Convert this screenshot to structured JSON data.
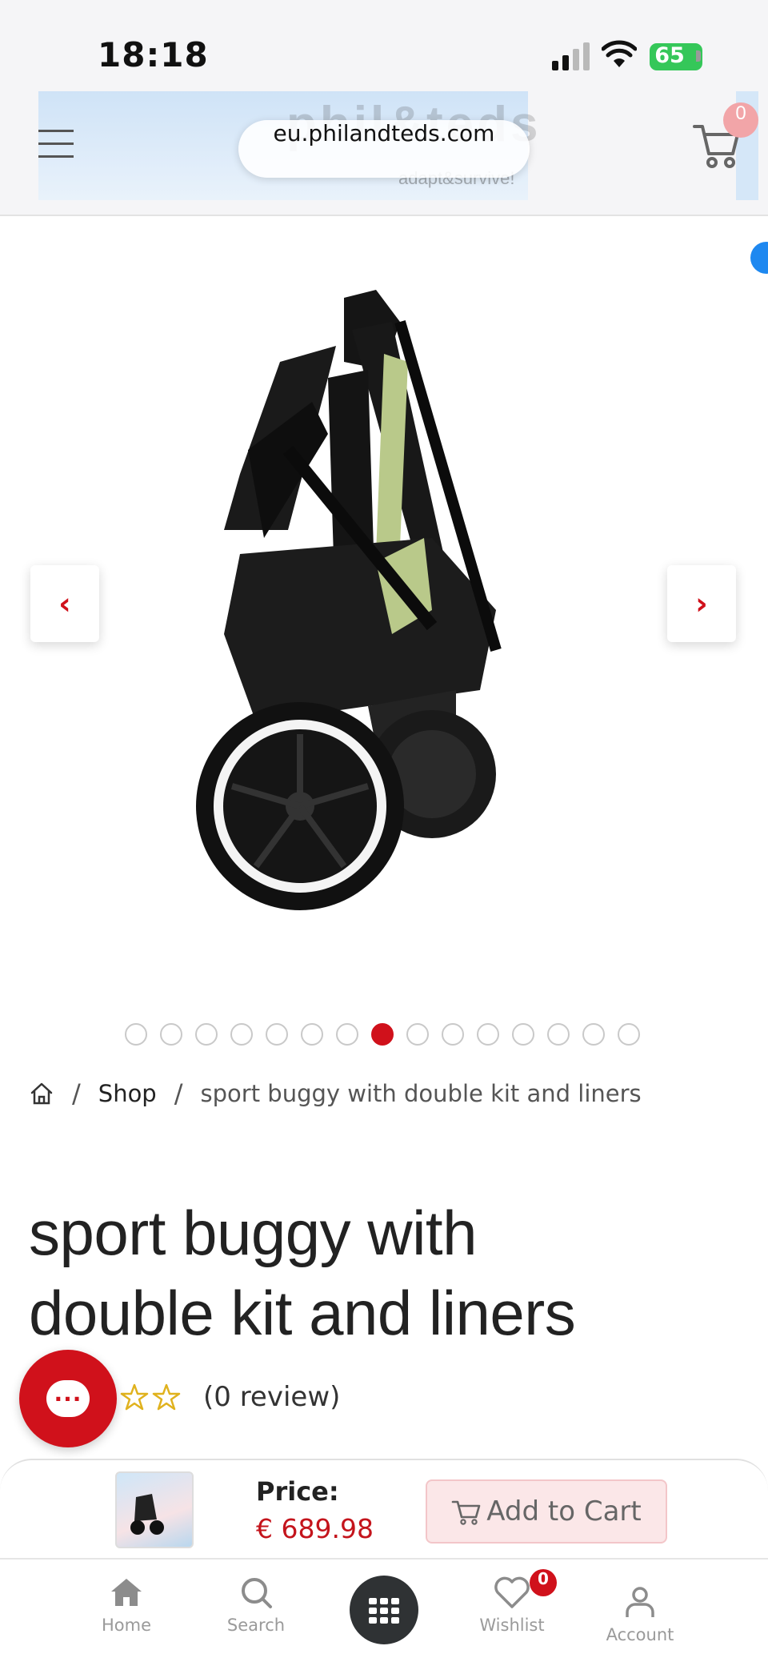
{
  "status_bar": {
    "time": "18:18",
    "battery": "65"
  },
  "header": {
    "url": "eu.philandteds.com",
    "cart_count": "0"
  },
  "gallery": {
    "slide_count": 15,
    "active_slide": 8,
    "prev_symbol": "‹",
    "next_symbol": "›"
  },
  "breadcrumb": {
    "shop": "Shop",
    "current": "sport buggy with double kit and liners",
    "separator": "/"
  },
  "product": {
    "title_line1": "sport buggy with",
    "title_line2": "double kit and liners",
    "review_text": "(0 review)"
  },
  "cart_bar": {
    "price_label": "Price:",
    "price_value": "€ 689.98",
    "add_to_cart_label": "Add to Cart"
  },
  "bottom_nav": {
    "home": "Home",
    "search": "Search",
    "wishlist": "Wishlist",
    "account": "Account",
    "wishlist_count": "0"
  },
  "colors": {
    "brand_red": "#d0111b",
    "price_red": "#c4141c",
    "battery_green": "#35c759"
  },
  "icons": [
    "hamburger-icon",
    "cart-icon",
    "home-icon",
    "star-icon",
    "chat-icon",
    "search-icon",
    "grid-icon",
    "heart-icon",
    "user-icon"
  ]
}
